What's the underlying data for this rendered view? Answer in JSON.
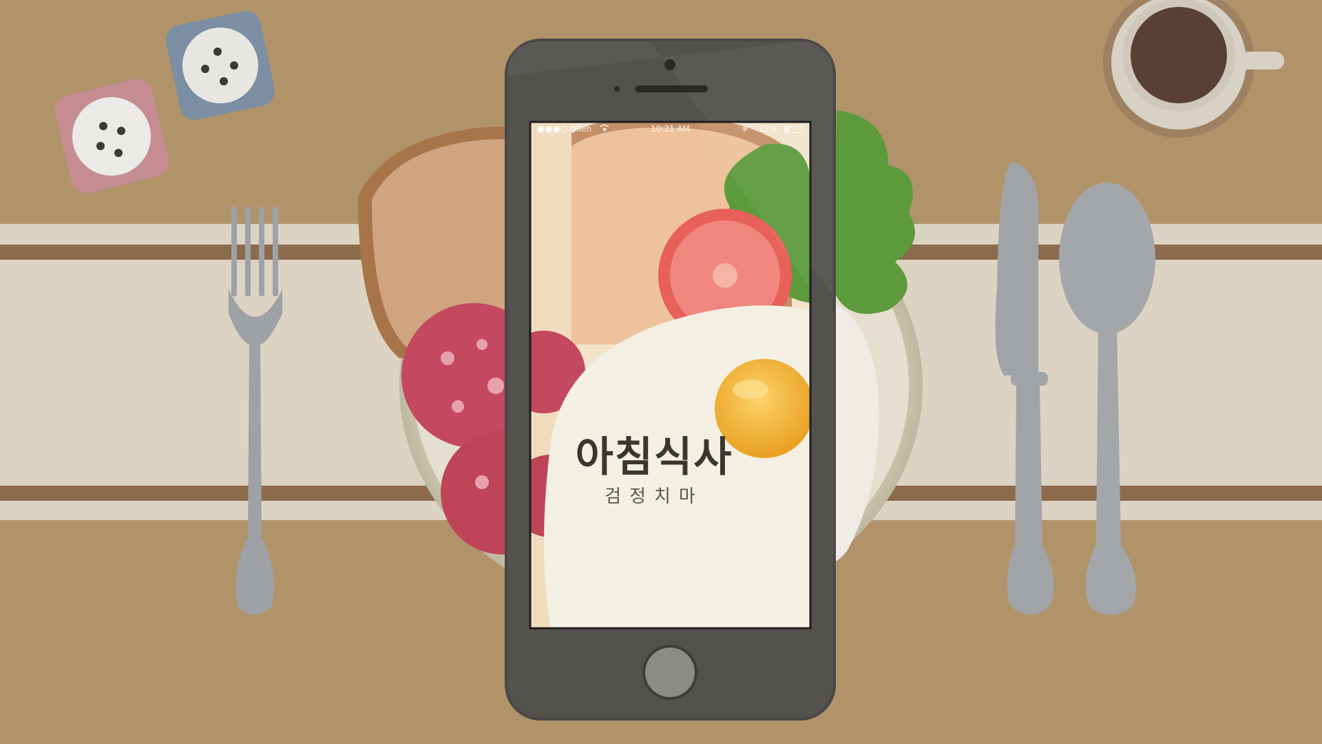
{
  "app": {
    "title": "아침식사",
    "subtitle": "검정치마"
  },
  "status_bar": {
    "signal": "●●●○○",
    "carrier": "olleh",
    "wifi_icon": "wifi-icon",
    "time": "10:21 AM",
    "bluetooth_icon": "bluetooth-icon",
    "battery": "22%",
    "battery_level": 0.22
  },
  "colors": {
    "table": "#b1936a",
    "runner": "#dcd3c2",
    "runner_stripe": "#8c6b4c",
    "phone_body": "#4d4b49",
    "yolk": "#f0a82c",
    "tomato": "#e8605a",
    "salami": "#c4485e",
    "lettuce": "#5c9a3c"
  },
  "icons": {
    "home_button": "home-button-icon",
    "camera": "front-camera-icon",
    "speaker": "speaker-grille-icon"
  }
}
